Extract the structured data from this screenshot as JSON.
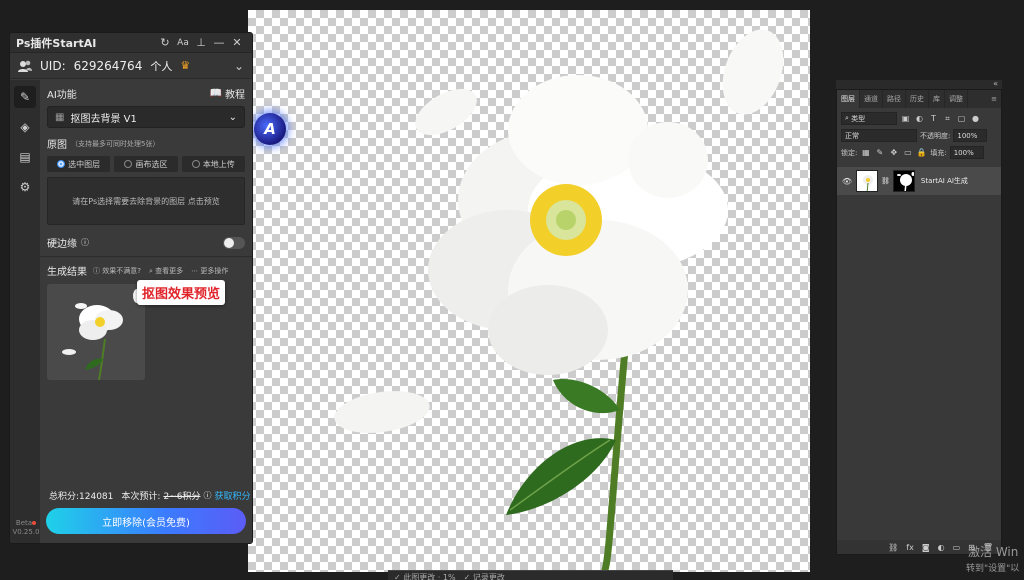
{
  "plugin": {
    "title": "Ps插件StartAI",
    "uid_label": "UID:",
    "uid_value": "629264764",
    "tier": "个人",
    "ai_function_label": "AI功能",
    "tutorial_label": "教程",
    "function_select": "抠图去背景 V1",
    "source_label": "原图",
    "source_note": "（支持最多可同时处理5张）",
    "source_options": [
      "选中图层",
      "画布选区",
      "本地上传"
    ],
    "hint": "请在Ps选择需要去除背景的图层 点击预览",
    "hard_edge_label": "硬边缘",
    "results_label": "生成结果",
    "results_links": [
      "效果不满意?",
      "查看更多",
      "更多操作"
    ],
    "preview_badge": "抠图效果预览",
    "points_label": "总积分:124081",
    "estimate_label": "本次预计:",
    "estimate_value": "2~6积分",
    "get_points": "获取积分",
    "cta": "立即移除(会员免费)",
    "version_beta": "Beta",
    "version": "V0.25.0"
  },
  "layers_panel": {
    "tabs": [
      "图层",
      "通道",
      "路径",
      "历史",
      "库",
      "调整"
    ],
    "filter_label": "类型",
    "blend_mode": "正常",
    "opacity_label": "不透明度:",
    "opacity_value": "100%",
    "lock_label": "锁定:",
    "fill_label": "填充:",
    "fill_value": "100%",
    "layer_name": "StartAI AI生成",
    "bottom_icons": [
      "fx"
    ]
  },
  "bottom_toolbar": [
    "✓ 此图更改 · 1%",
    "✓ 记录更改"
  ],
  "os_watermark": {
    "line1": "激活 Win",
    "line2": "转到\"设置\"以"
  },
  "colors": {
    "accent_blue": "#3b8ef0",
    "badge_red": "#e0242b",
    "coin": "#f5b50a",
    "link": "#34b9ff"
  }
}
